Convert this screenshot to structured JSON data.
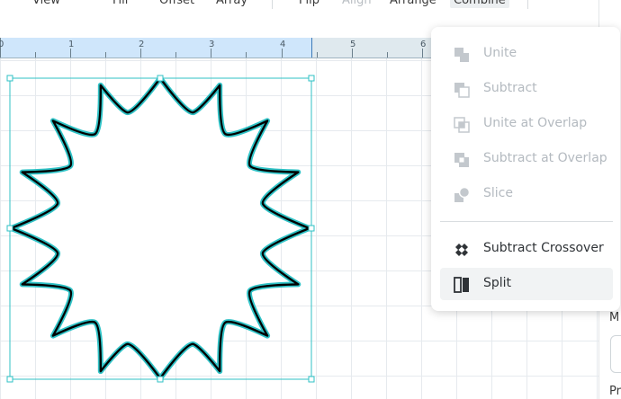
{
  "toolbar": {
    "items": [
      {
        "label": "View",
        "state": "normal"
      },
      {
        "label": "Fill",
        "state": "normal"
      },
      {
        "label": "Offset",
        "state": "normal"
      },
      {
        "label": "Array",
        "state": "normal"
      },
      {
        "label": "Flip",
        "state": "normal"
      },
      {
        "label": "Align",
        "state": "disabled"
      },
      {
        "label": "Arrange",
        "state": "normal"
      },
      {
        "label": "Combine",
        "state": "active"
      }
    ]
  },
  "ruler": {
    "labels": [
      "0",
      "1",
      "2",
      "3",
      "4",
      "5",
      "6"
    ]
  },
  "combine_menu": {
    "items": [
      {
        "label": "Unite",
        "icon": "unite-icon",
        "enabled": false
      },
      {
        "label": "Subtract",
        "icon": "subtract-icon",
        "enabled": false
      },
      {
        "label": "Unite at Overlap",
        "icon": "unite-at-overlap-icon",
        "enabled": false
      },
      {
        "label": "Subtract at Overlap",
        "icon": "subtract-at-overlap-icon",
        "enabled": false
      },
      {
        "label": "Slice",
        "icon": "slice-icon",
        "enabled": false
      },
      {
        "label": "Subtract Crossover",
        "icon": "subtract-crossover-icon",
        "enabled": true
      },
      {
        "label": "Split",
        "icon": "split-icon",
        "enabled": true,
        "highlighted": true
      }
    ]
  },
  "right_panel": {
    "label_1": "M",
    "label_2": "Pr"
  },
  "colors": {
    "selection": "#2fc2c6",
    "shape_outline": "#000000",
    "menu_disabled": "#b4bac0",
    "ruler_highlight": "#cfe6fb"
  }
}
